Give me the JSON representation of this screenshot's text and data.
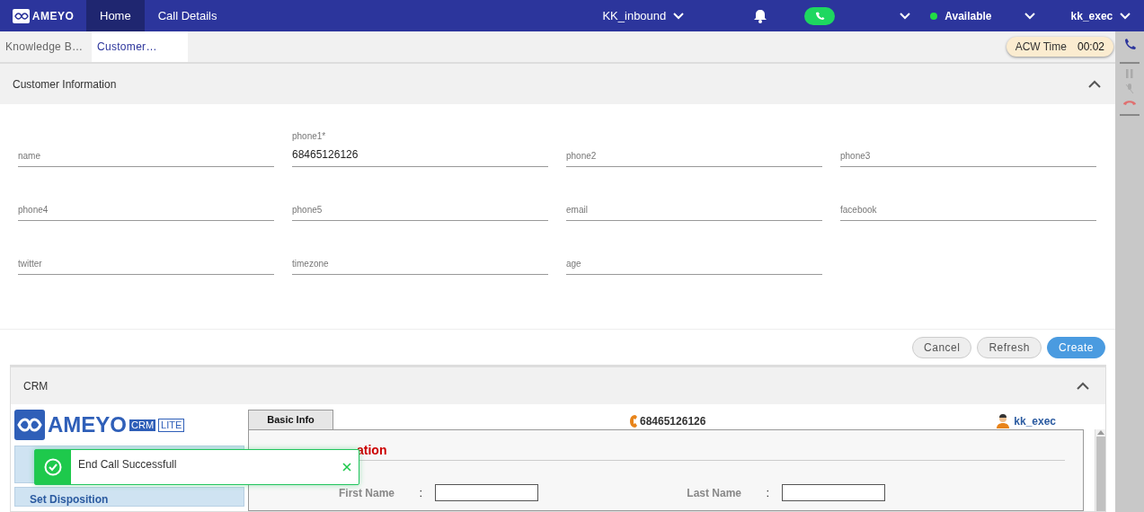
{
  "topbar": {
    "logo": "AMEYO",
    "nav": [
      {
        "label": "Home",
        "selected": true
      },
      {
        "label": "Call Details",
        "selected": false
      }
    ],
    "campaign": "KK_inbound",
    "status": "Available",
    "user": "kk_exec"
  },
  "tabs": [
    {
      "label": "Knowledge B…",
      "selected": false
    },
    {
      "label": "Customer…",
      "selected": true
    }
  ],
  "acw": {
    "label": "ACW Time",
    "time": "00:02"
  },
  "customer_info": {
    "title": "Customer Information",
    "expanded": true,
    "fields": [
      {
        "label": "name"
      },
      {
        "label": "phone1*",
        "value": "68465126126"
      },
      {
        "label": "phone2"
      },
      {
        "label": "phone3"
      },
      {
        "label": "phone4"
      },
      {
        "label": "phone5"
      },
      {
        "label": "email"
      },
      {
        "label": "facebook"
      },
      {
        "label": "twitter"
      },
      {
        "label": "timezone"
      },
      {
        "label": "age"
      }
    ],
    "buttons": [
      {
        "label": "Cancel",
        "kind": "plain"
      },
      {
        "label": "Refresh",
        "kind": "plain"
      },
      {
        "label": "Create",
        "kind": "primary"
      }
    ]
  },
  "crm": {
    "title": "CRM",
    "expanded": true,
    "logo": "AMEYO",
    "logo_tags": [
      "CRM",
      "LITE"
    ],
    "tab": "Basic Info",
    "phone": "68465126126",
    "agent": "kk_exec",
    "section_title": "ation",
    "menu": [
      "Set Disposition"
    ],
    "form": [
      {
        "label": "First Name",
        "sep": ":"
      },
      {
        "label": "Last Name",
        "sep": ":"
      }
    ]
  },
  "toast": {
    "message": "End Call Successfull"
  }
}
